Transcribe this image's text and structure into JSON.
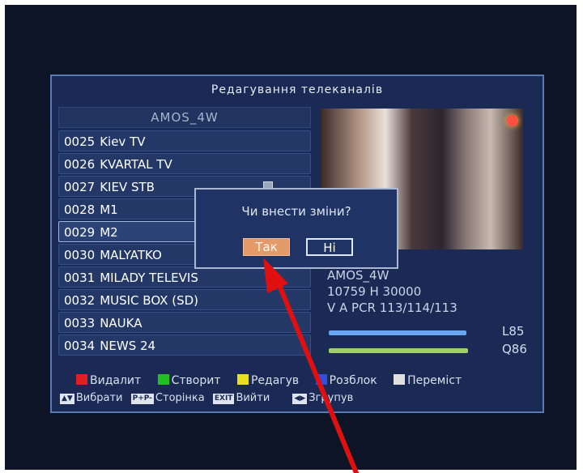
{
  "screen": {
    "title": "Редагування телеканалів",
    "satellite": "AMOS_4W",
    "channels": [
      {
        "num": "0025",
        "name": "Kiev TV"
      },
      {
        "num": "0026",
        "name": "KVARTAL TV"
      },
      {
        "num": "0027",
        "name": "KIEV STB"
      },
      {
        "num": "0028",
        "name": "M1"
      },
      {
        "num": "0029",
        "name": "M2"
      },
      {
        "num": "0030",
        "name": "MALYATKO"
      },
      {
        "num": "0031",
        "name": "MILADY TELEVIS"
      },
      {
        "num": "0032",
        "name": "MUSIC BOX (SD)"
      },
      {
        "num": "0033",
        "name": "NAUKA"
      },
      {
        "num": "0034",
        "name": "NEWS 24"
      }
    ],
    "selected_channel_index": 4,
    "info": {
      "sat": "AMOS_4W",
      "freq": "10759 H 30000",
      "pids": "V A PCR 113/114/113"
    },
    "signal": {
      "level_label": "L85",
      "level": 0.85,
      "quality_label": "Q86",
      "quality": 0.86
    },
    "legend": {
      "red": "Видалит",
      "green": "Створит",
      "yellow": "Редагув",
      "blue": "Розблок",
      "white": "Переміст",
      "updown_key": "▲▼",
      "updown": "Вибрати",
      "page_key": "P+P-",
      "page": "Сторінка",
      "exit_key": "EXIT",
      "exit": "Вийти",
      "lr_key": "◀▶",
      "lr": "Згрупув"
    },
    "dialog": {
      "question": "Чи внести зміни?",
      "yes": "Так",
      "no": "Ні"
    },
    "colors": {
      "red": "#e02020",
      "green": "#22c020",
      "yellow": "#e8e020",
      "blue": "#3050e0",
      "white": "#e0e0e0",
      "arrow": "#e01010",
      "level_bar": "#6aa6f0",
      "quality_bar": "#9fcf6a"
    }
  }
}
